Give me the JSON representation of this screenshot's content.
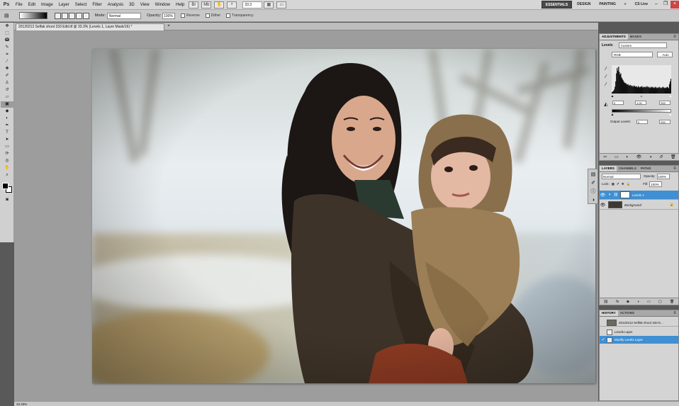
{
  "menubar": {
    "logo": "Ps",
    "items": [
      "File",
      "Edit",
      "Image",
      "Layer",
      "Select",
      "Filter",
      "Analysis",
      "3D",
      "View",
      "Window",
      "Help"
    ],
    "zoom": "33.3",
    "workspaces": [
      "ESSENTIALS",
      "DESIGN",
      "PAINTING"
    ],
    "more": "»",
    "live": "CS Live"
  },
  "options": {
    "mode_label": "Mode:",
    "mode_value": "Normal",
    "opacity_label": "Opacity:",
    "opacity_value": "100%",
    "reverse_label": "Reverse",
    "dither_label": "Dither",
    "transparency_label": "Transparency"
  },
  "document": {
    "tab_title": "20120212 Selfak shoot 333 Edit.tif @ 33.3% (Levels 1, Layer Mask/16) *",
    "status": "33.33%"
  },
  "adjustments": {
    "tabs": [
      "ADJUSTMENTS",
      "MASKS"
    ],
    "title": "Levels",
    "preset": "Custom",
    "channel": "RGB",
    "auto_label": "Auto",
    "input_black": "0",
    "input_gamma": "1.00",
    "input_white": "255",
    "output_label": "Output Levels:",
    "output_black": "0",
    "output_white": "255"
  },
  "layers": {
    "tabs": [
      "LAYERS",
      "CHANNELS",
      "PATHS"
    ],
    "blend_mode": "Normal",
    "opacity_label": "Opacity:",
    "opacity": "100%",
    "lock_label": "Lock:",
    "fill_label": "Fill:",
    "fill": "100%",
    "items": [
      {
        "name": "Levels 1",
        "selected": true
      },
      {
        "name": "Background",
        "selected": false
      }
    ]
  },
  "history": {
    "tabs": [
      "HISTORY",
      "ACTIONS"
    ],
    "snapshot": "20120212 Selfak shoot 333 E...",
    "items": [
      {
        "name": "Levels Layer",
        "selected": false
      },
      {
        "name": "Modify Levels Layer",
        "selected": true
      }
    ]
  },
  "colors": {
    "selection": "#3f8fd2",
    "chrome": "#d4d4d4",
    "canvas_bg": "#9d9d9d"
  },
  "histogram_data": [
    2,
    3,
    4,
    6,
    10,
    18,
    30,
    38,
    34,
    40,
    32,
    28,
    30,
    24,
    22,
    20,
    18,
    16,
    16,
    15,
    14,
    13,
    14,
    12,
    12,
    13,
    11,
    12,
    11,
    10,
    12,
    11,
    10,
    11,
    10,
    9,
    11,
    10,
    9,
    10,
    10,
    11,
    9,
    10,
    9,
    10,
    10,
    9,
    11,
    10,
    9,
    10,
    8,
    9,
    10,
    9,
    10,
    8,
    9,
    9,
    10,
    8,
    9,
    8,
    9,
    10,
    8,
    9,
    8,
    9,
    10,
    9,
    8,
    9,
    8,
    9,
    10,
    9,
    8,
    14,
    18,
    22
  ]
}
